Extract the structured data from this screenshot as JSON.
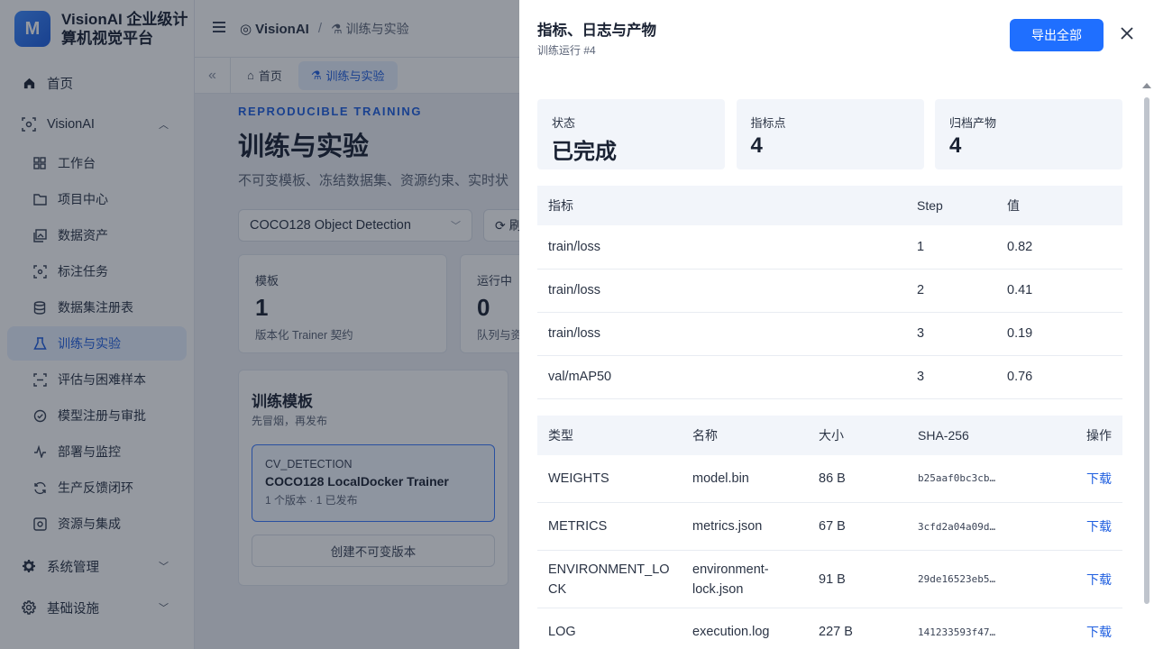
{
  "brand": {
    "logo": "M",
    "title": "VisionAI 企业级计算机视觉平台"
  },
  "nav": {
    "home": "首页",
    "visionai": "VisionAI",
    "items": [
      "工作台",
      "项目中心",
      "数据资产",
      "标注任务",
      "数据集注册表",
      "训练与实验",
      "评估与困难样本",
      "模型注册与审批",
      "部署与监控",
      "生产反馈闭环",
      "资源与集成"
    ],
    "system": "系统管理",
    "infra": "基础设施"
  },
  "breadcrumb": {
    "root": "VisionAI",
    "sep": "/",
    "current": "训练与实验"
  },
  "tabs": [
    {
      "label": "首页"
    },
    {
      "label": "训练与实验"
    }
  ],
  "main": {
    "eyebrow": "REPRODUCIBLE TRAINING",
    "title": "训练与实验",
    "subtitle": "不可变模板、冻结数据集、资源约束、实时状",
    "select_value": "COCO128 Object Detection",
    "refresh_label": "刷",
    "stats": [
      {
        "label": "模板",
        "value": "1",
        "desc": "版本化 Trainer 契约"
      },
      {
        "label": "运行中",
        "value": "0",
        "desc": "队列与资"
      }
    ],
    "templates": {
      "title": "训练模板",
      "subtitle": "先冒烟，再发布",
      "item": {
        "kind": "CV_DETECTION",
        "name": "COCO128 LocalDocker Trainer",
        "meta": "1 个版本 · 1 已发布"
      },
      "create_label": "创建不可变版本"
    }
  },
  "drawer": {
    "title": "指标、日志与产物",
    "subtitle": "训练运行 #4",
    "export_label": "导出全部",
    "stats": [
      {
        "label": "状态",
        "value": "已完成"
      },
      {
        "label": "指标点",
        "value": "4"
      },
      {
        "label": "归档产物",
        "value": "4"
      }
    ],
    "metrics": {
      "headers": [
        "指标",
        "Step",
        "值"
      ],
      "rows": [
        [
          "train/loss",
          "1",
          "0.82"
        ],
        [
          "train/loss",
          "2",
          "0.41"
        ],
        [
          "train/loss",
          "3",
          "0.19"
        ],
        [
          "val/mAP50",
          "3",
          "0.76"
        ]
      ]
    },
    "artifacts": {
      "headers": [
        "类型",
        "名称",
        "大小",
        "SHA-256",
        "操作"
      ],
      "rows": [
        {
          "type": "WEIGHTS",
          "name": "model.bin",
          "size": "86 B",
          "sha": "b25aaf0bc3cb…",
          "action": "下载"
        },
        {
          "type": "METRICS",
          "name": "metrics.json",
          "size": "67 B",
          "sha": "3cfd2a04a09d…",
          "action": "下载"
        },
        {
          "type": "ENVIRONMENT_LOCK",
          "name": "environment-lock.json",
          "size": "91 B",
          "sha": "29de16523eb5…",
          "action": "下载"
        },
        {
          "type": "LOG",
          "name": "execution.log",
          "size": "227 B",
          "sha": "141233593f47…",
          "action": "下载"
        }
      ]
    }
  },
  "colors": {
    "accent": "#1f6fff",
    "active_bg": "#e8f0ff",
    "overlay": "#141c2d"
  }
}
